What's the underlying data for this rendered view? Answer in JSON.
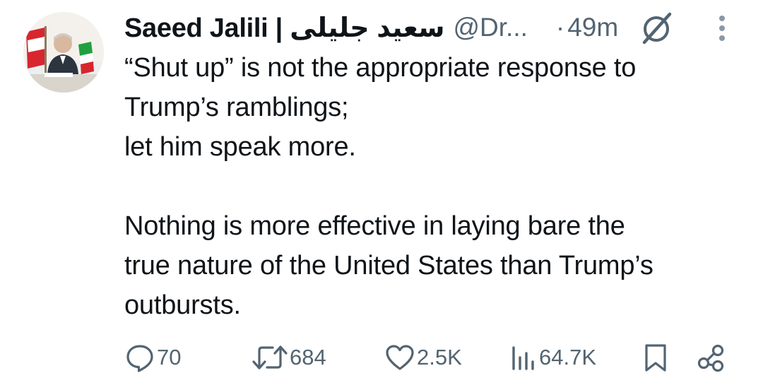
{
  "author": {
    "display_name": "Saeed Jalili | سعيد جليلى",
    "handle": "@Dr...",
    "separator": "·",
    "time": "49m"
  },
  "icons": {
    "avatar": "avatar-photo",
    "grok": "grok-slash-icon",
    "more": "vertical-dots-icon",
    "reply": "comment-bubble-icon",
    "repost": "repost-arrows-icon",
    "like": "heart-icon",
    "views": "bar-chart-icon",
    "bookmark": "bookmark-icon",
    "share": "share-nodes-icon"
  },
  "tweet": {
    "lines": [
      "“Shut up” is not the appropriate response to",
      "Trump’s ramblings;",
      "let him speak more.",
      "",
      "Nothing is more effective in laying bare the",
      "true nature of the United States than Trump’s",
      "outbursts."
    ]
  },
  "stats": {
    "replies": "70",
    "reposts": "684",
    "likes": "2.5K",
    "views": "64.7K"
  },
  "colors": {
    "text": "#0f1419",
    "secondary": "#536471",
    "background": "#ffffff"
  }
}
